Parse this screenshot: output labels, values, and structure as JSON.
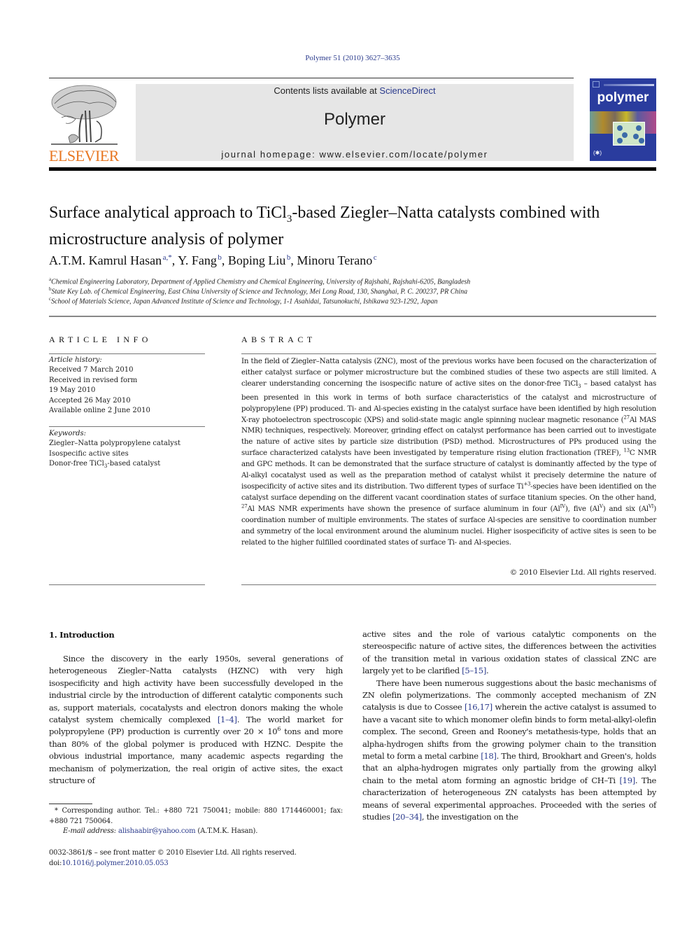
{
  "header": {
    "citation": "Polymer 51 (2010) 3627–3635",
    "contents_prefix": "Contents lists available at ",
    "contents_link": "ScienceDirect",
    "journal_name": "Polymer",
    "homepage_prefix": "journal homepage: ",
    "homepage_url": "www.elsevier.com/locate/polymer",
    "publisher_logo_text": "ELSEVIER",
    "cover_title": "polymer",
    "brand_color": "#e87722",
    "link_color": "#2a3a8c",
    "cover_color": "#2a3c9e"
  },
  "article": {
    "title_part1": "Surface analytical approach to TiCl",
    "title_sub": "3",
    "title_part2": "-based Ziegler–Natta catalysts combined with microstructure analysis of polymer",
    "authors": [
      {
        "name": "A.T.M. Kamrul Hasan",
        "sup": "a,*"
      },
      {
        "name": "Y. Fang",
        "sup": "b"
      },
      {
        "name": "Boping Liu",
        "sup": "b"
      },
      {
        "name": "Minoru Terano",
        "sup": "c"
      }
    ],
    "affiliations": [
      {
        "mark": "a",
        "text": "Chemical Engineering Laboratory, Department of Applied Chemistry and Chemical Engineering, University of Rajshahi, Rajshahi-6205, Bangladesh"
      },
      {
        "mark": "b",
        "text": "State Key Lab. of Chemical Engineering, East China University of Science and Technology, Mei Long Road, 130, Shanghai, P. C. 200237, PR China"
      },
      {
        "mark": "c",
        "text": "School of Materials Science, Japan Advanced Institute of Science and Technology, 1-1 Asahidai, Tatsunokuchi, Ishikawa 923-1292, Japan"
      }
    ]
  },
  "article_info": {
    "heading": "ARTICLE INFO",
    "history_label": "Article history:",
    "history": [
      "Received 7 March 2010",
      "Received in revised form",
      "19 May 2010",
      "Accepted 26 May 2010",
      "Available online 2 June 2010"
    ],
    "keywords_label": "Keywords:",
    "keywords": [
      "Ziegler–Natta polypropylene catalyst",
      "Isospecific active sites"
    ],
    "keyword3_part1": "Donor-free TiCl",
    "keyword3_sub": "3",
    "keyword3_part2": "-based catalyst"
  },
  "abstract": {
    "heading": "ABSTRACT",
    "t1": "In the field of Ziegler–Natta catalysis (ZNC), most of the previous works have been focused on the characterization of either catalyst surface or polymer microstructure but the combined studies of these two aspects are still limited. A clearer understanding concerning the isospecific nature of active sites on the donor-free TiCl",
    "sub3": "3",
    "t2": " – based catalyst has been presented in this work in terms of both surface characteristics of the catalyst and microstructure of polypropylene (PP) produced. Ti- and Al-species existing in the catalyst surface have been identified by high resolution X-ray photoelectron spectroscopic (XPS) and solid-state magic angle spinning nuclear magnetic resonance (",
    "sup27": "27",
    "t3": "Al MAS NMR) techniques, respectively. Moreover, grinding effect on catalyst performance has been carried out to investigate the nature of active sites by particle size distribution (PSD) method. Microstructures of PPs produced using the surface characterized catalysts have been investigated by temperature rising elution fractionation (TREF), ",
    "sup13": "13",
    "t4": "C NMR and GPC methods. It can be demonstrated that the surface structure of catalyst is dominantly affected by the type of Al-alkyl cocatalyst used as well as the preparation method of catalyst whilst it precisely determine the nature of isospecificity of active sites and its distribution. Two different types of surface Ti",
    "sup_ti": "+3",
    "t5": "-species have been identified on the catalyst surface depending on the different vacant coordination states of surface titanium species. On the other hand, ",
    "sup27b": "27",
    "t6": "Al MAS NMR experiments have shown the presence of surface aluminum in four (Al",
    "sup_iv": "IV",
    "t7": "), five (Al",
    "sup_v": "V",
    "t8": ") and six (Al",
    "sup_vi": "VI",
    "t9": ") coordination number of multiple environments. The states of surface Al-species are sensitive to coordination number and symmetry of the local environment around the aluminum nuclei. Higher isospecificity of active sites is seen to be related to the higher fulfilled coordinated states of surface Ti- and Al-species.",
    "copyright": "© 2010 Elsevier Ltd. All rights reserved."
  },
  "introduction": {
    "heading": "1.  Introduction",
    "p1_a": "Since the discovery in the early 1950s, several generations of heterogeneous Ziegler–Natta catalysts (HZNC) with very high isospecificity and high activity have been successfully developed in the industrial circle by the introduction of different catalytic components such as, support materials, cocatalysts and electron donors making the whole catalyst system chemically complexed ",
    "ref1": "[1–4]",
    "p1_b": ". The world market for polypropylene (PP) production is currently over 20 × 10",
    "p1_sup": "6",
    "p1_c": " tons and more than 80% of the global polymer is produced with HZNC. Despite the obvious industrial importance, many academic aspects regarding the mechanism of polymerization, the real origin of active sites, the exact structure of",
    "p1_cont": "active sites and the role of various catalytic components on the stereospecific nature of active sites, the differences between the activities of the transition metal in various oxidation states of classical ZNC are largely yet to be clarified ",
    "ref2": "[5–15]",
    "p1_end": ".",
    "p2_a": "There have been numerous suggestions about the basic mechanisms of ZN olefin polymerizations. The commonly accepted mechanism of ZN catalysis is due to Cossee ",
    "ref3": "[16,17]",
    "p2_b": " wherein the active catalyst is assumed to have a vacant site to which monomer olefin binds to form metal-alkyl-olefin complex. The second, Green and Rooney's metathesis-type, holds that an alpha-hydrogen shifts from the growing polymer chain to the transition metal to form a metal carbine ",
    "ref4": "[18]",
    "p2_c": ". The third, Brookhart and Green's, holds that an alpha-hydrogen migrates only partially from the growing alkyl chain to the metal atom forming an agnostic bridge of CH–Ti ",
    "ref5": "[19]",
    "p2_d": ". The characterization of heterogeneous ZN catalysts has been attempted by means of several experimental approaches. Proceeded with the series of studies ",
    "ref6": "[20–34]",
    "p2_e": ", the investigation on the"
  },
  "footnotes": {
    "corresponding": "* Corresponding author. Tel.: +880 721 750041; mobile: 880 1714460001; fax: +880 721 750064.",
    "email_label": "E-mail address: ",
    "email": "alishaabir@yahoo.com",
    "email_suffix": " (A.T.M.K. Hasan).",
    "issn": "0032-3861/$ – see front matter © 2010 Elsevier Ltd. All rights reserved.",
    "doi_label": "doi:",
    "doi": "10.1016/j.polymer.2010.05.053"
  }
}
